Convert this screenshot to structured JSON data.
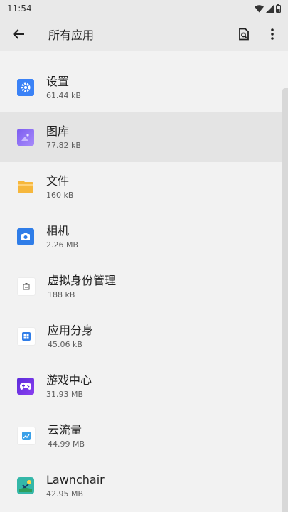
{
  "status_bar": {
    "time": "11:54"
  },
  "app_bar": {
    "title": "所有应用"
  },
  "colors": {
    "background": "#f2f2f2",
    "app_bar": "#e9e9e9",
    "highlight": "#e4e4e4"
  },
  "apps": [
    {
      "name": "设置",
      "size": "61.44 kB",
      "icon": "settings-gear-icon"
    },
    {
      "name": "图库",
      "size": "77.82 kB",
      "icon": "gallery-icon"
    },
    {
      "name": "文件",
      "size": "160 kB",
      "icon": "folder-icon"
    },
    {
      "name": "相机",
      "size": "2.26 MB",
      "icon": "camera-icon"
    },
    {
      "name": "虚拟身份管理",
      "size": "188 kB",
      "icon": "virtual-identity-icon"
    },
    {
      "name": "应用分身",
      "size": "45.06 kB",
      "icon": "app-clone-icon"
    },
    {
      "name": "游戏中心",
      "size": "31.93 MB",
      "icon": "gamepad-icon"
    },
    {
      "name": "云流量",
      "size": "44.99 MB",
      "icon": "cloud-traffic-icon"
    },
    {
      "name": "Lawnchair",
      "size": "42.95 MB",
      "icon": "lawnchair-icon"
    }
  ]
}
